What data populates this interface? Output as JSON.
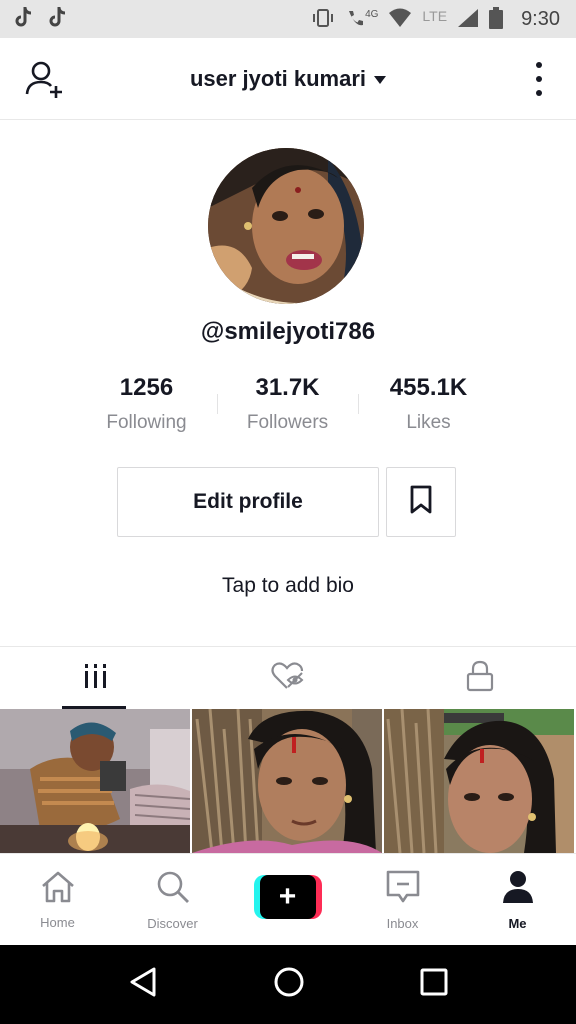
{
  "status_bar": {
    "time": "9:30",
    "network_label": "4G",
    "lte_label": "LTE",
    "app_icons": [
      "tiktok-icon",
      "tiktok-icon"
    ]
  },
  "header": {
    "title": "user jyoti kumari",
    "left_icon": "add-user-icon",
    "right_icon": "more-vertical-icon"
  },
  "profile": {
    "username": "@smilejyoti786",
    "stats": [
      {
        "value": "1256",
        "label": "Following"
      },
      {
        "value": "31.7K",
        "label": "Followers"
      },
      {
        "value": "455.1K",
        "label": "Likes"
      }
    ],
    "edit_label": "Edit profile",
    "bio_placeholder": "Tap to add bio"
  },
  "tabs": [
    {
      "icon": "grid-icon",
      "active": true
    },
    {
      "icon": "liked-hidden-icon",
      "active": false
    },
    {
      "icon": "lock-icon",
      "active": false
    }
  ],
  "bottom_nav": [
    {
      "label": "Home",
      "icon": "home-icon"
    },
    {
      "label": "Discover",
      "icon": "search-icon"
    },
    {
      "label": "",
      "icon": "plus-icon"
    },
    {
      "label": "Inbox",
      "icon": "inbox-icon"
    },
    {
      "label": "Me",
      "icon": "person-icon"
    }
  ],
  "colors": {
    "text": "#161823",
    "muted": "#8a8b91",
    "cyan": "#25f4ee",
    "pink": "#fe2c55"
  }
}
